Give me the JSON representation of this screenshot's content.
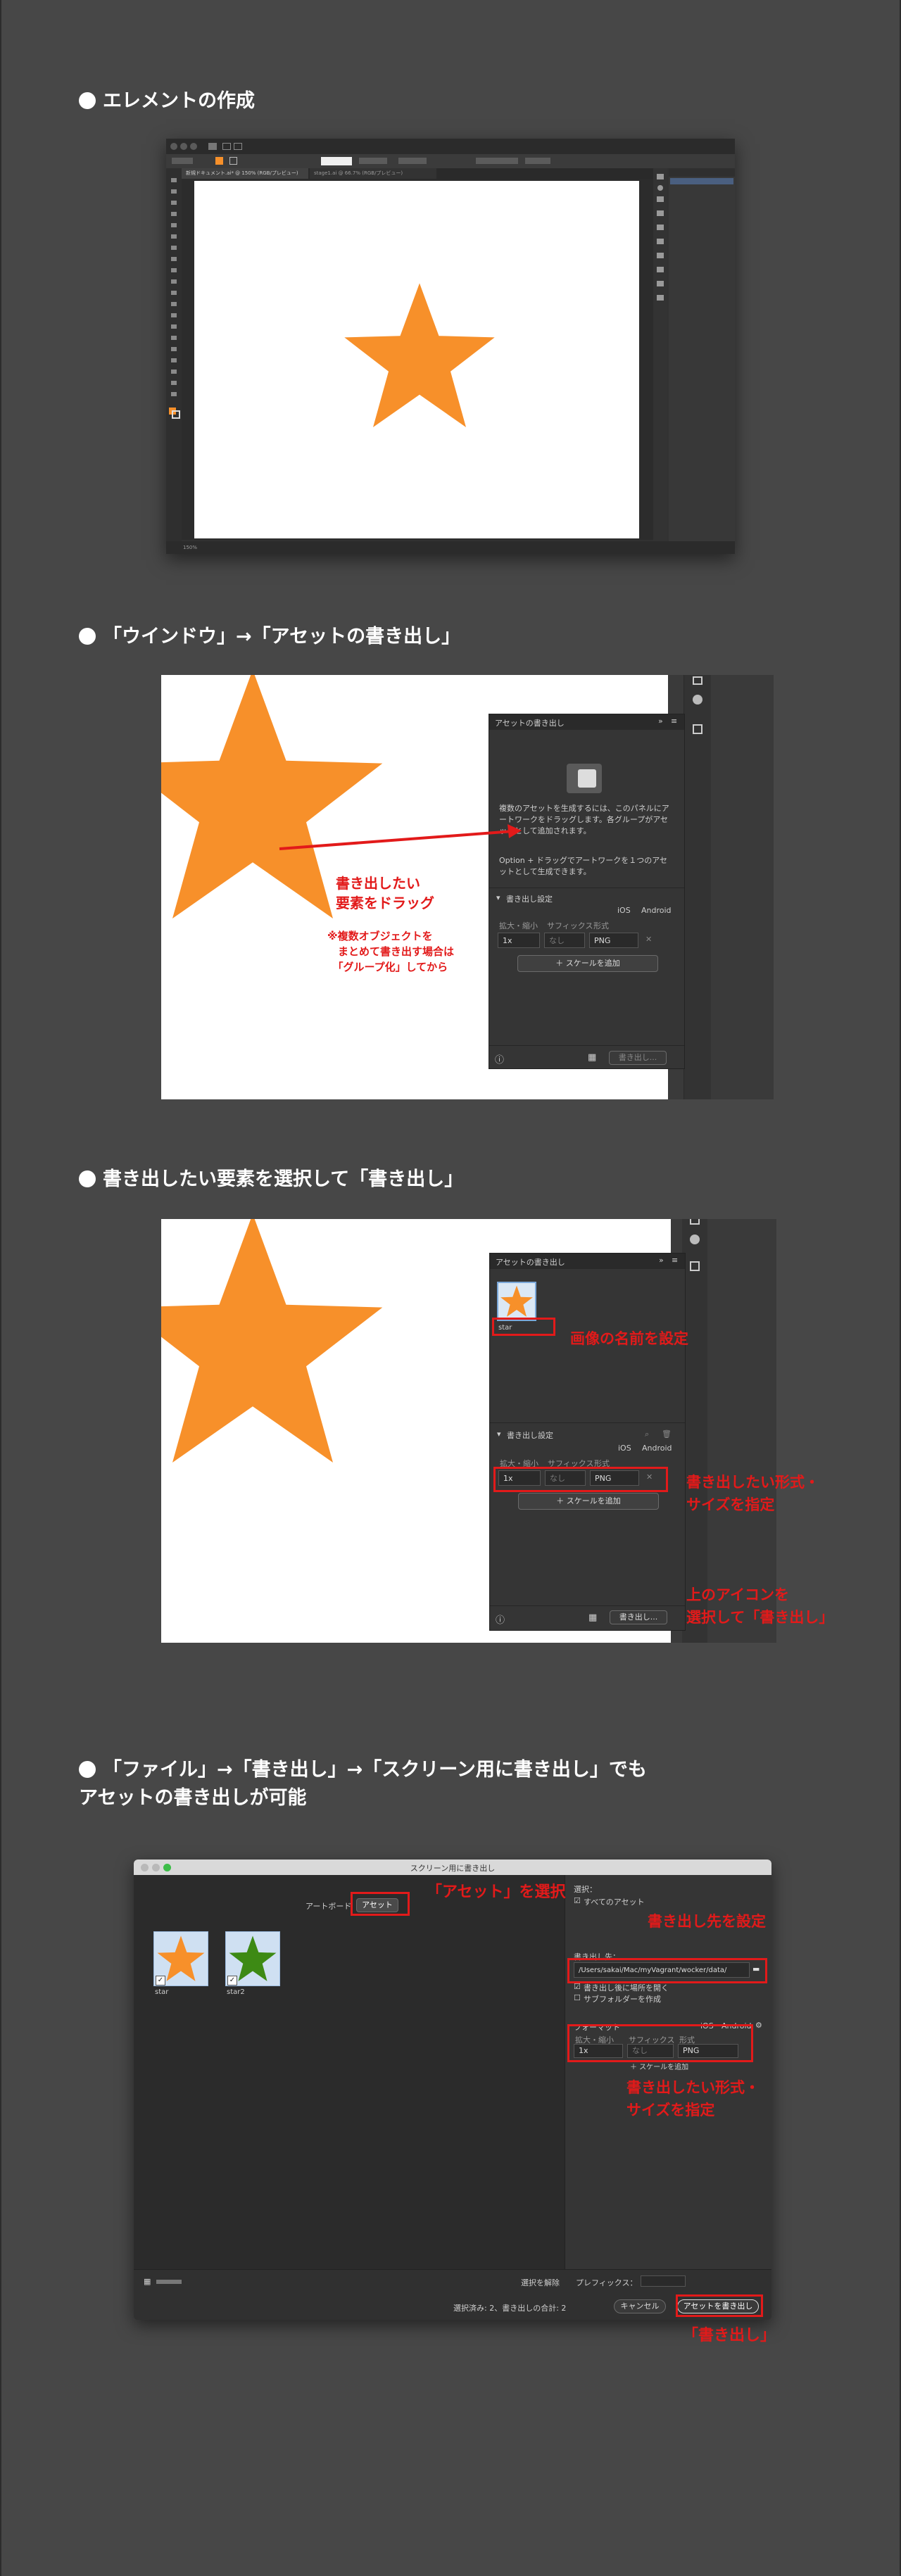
{
  "section1": {
    "heading": "エレメントの作成",
    "app_tab_1": "新規ドキュメント.ai* @ 150% (RGB/プレビュー)",
    "app_tab_2": "stage1.ai @ 66.7% (RGB/プレビュー)",
    "zoom": "150%"
  },
  "section2": {
    "heading": "「ウインドウ」→「アセットの書き出し」",
    "panel_title": "アセットの書き出し",
    "help_text_1": "複数のアセットを生成するには、このパネルにアートワークをドラッグします。各グループがアセットとして追加されます。",
    "help_text_2": "Option + ドラッグでアートワークを１つのアセットとして生成できます。",
    "settings_label": "書き出し設定",
    "ios": "iOS",
    "android": "Android",
    "col_scale": "拡大・縮小",
    "col_suffix": "サフィックス",
    "col_format": "形式",
    "scale_value": "1x",
    "suffix_value": "なし",
    "format_value": "PNG",
    "add_scale": "＋ スケールを追加",
    "export_button": "書き出し...",
    "annotation_1": "書き出したい\n要素をドラッグ",
    "annotation_2": "※複数オブジェクトを\n　まとめて書き出す場合は\n　「グループ化」してから"
  },
  "section3": {
    "heading": "書き出したい要素を選択して「書き出し」",
    "asset_name": "star",
    "annotation_name": "画像の名前を設定",
    "annotation_format": "書き出したい形式・\nサイズを指定",
    "annotation_export": "上のアイコンを\n選択して「書き出し」"
  },
  "section4": {
    "heading": "「ファイル」→「書き出し」→「スクリーン用に書き出し」でも\nアセットの書き出しが可能",
    "dialog_title": "スクリーン用に書き出し",
    "tab_artboard": "アートボード",
    "tab_asset": "アセット",
    "annotation_asset": "「アセット」を選択",
    "asset1_name": "star",
    "asset2_name": "star2",
    "select_label": "選択：",
    "all_assets": "すべてのアセット",
    "annotation_dest": "書き出し先を設定",
    "export_to_label": "書き出し先：",
    "export_path": "/Users/sakai/Mac/myVagrant/wocker/data/",
    "open_after": "書き出し後に場所を開く",
    "subfolder": "サブフォルダーを作成",
    "format_label": "フォーマット",
    "ios": "iOS",
    "android": "Android",
    "col_scale": "拡大・縮小",
    "col_suffix": "サフィックス",
    "col_format": "形式",
    "scale_value": "1x",
    "suffix_value": "なし",
    "format_value": "PNG",
    "add_scale": "＋ スケールを追加",
    "annotation_format": "書き出したい形式・\nサイズを指定",
    "deselect": "選択を解除",
    "prefix_label": "プレフィックス：",
    "count_text": "選択済み: 2、書き出しの合計: 2",
    "cancel": "キャンセル",
    "export_assets": "アセットを書き出し",
    "annotation_export": "「書き出し」"
  },
  "colors": {
    "background": "#474747",
    "accent_red": "#e21a1a",
    "star_orange": "#f7902a",
    "star_green": "#3d8a14"
  }
}
